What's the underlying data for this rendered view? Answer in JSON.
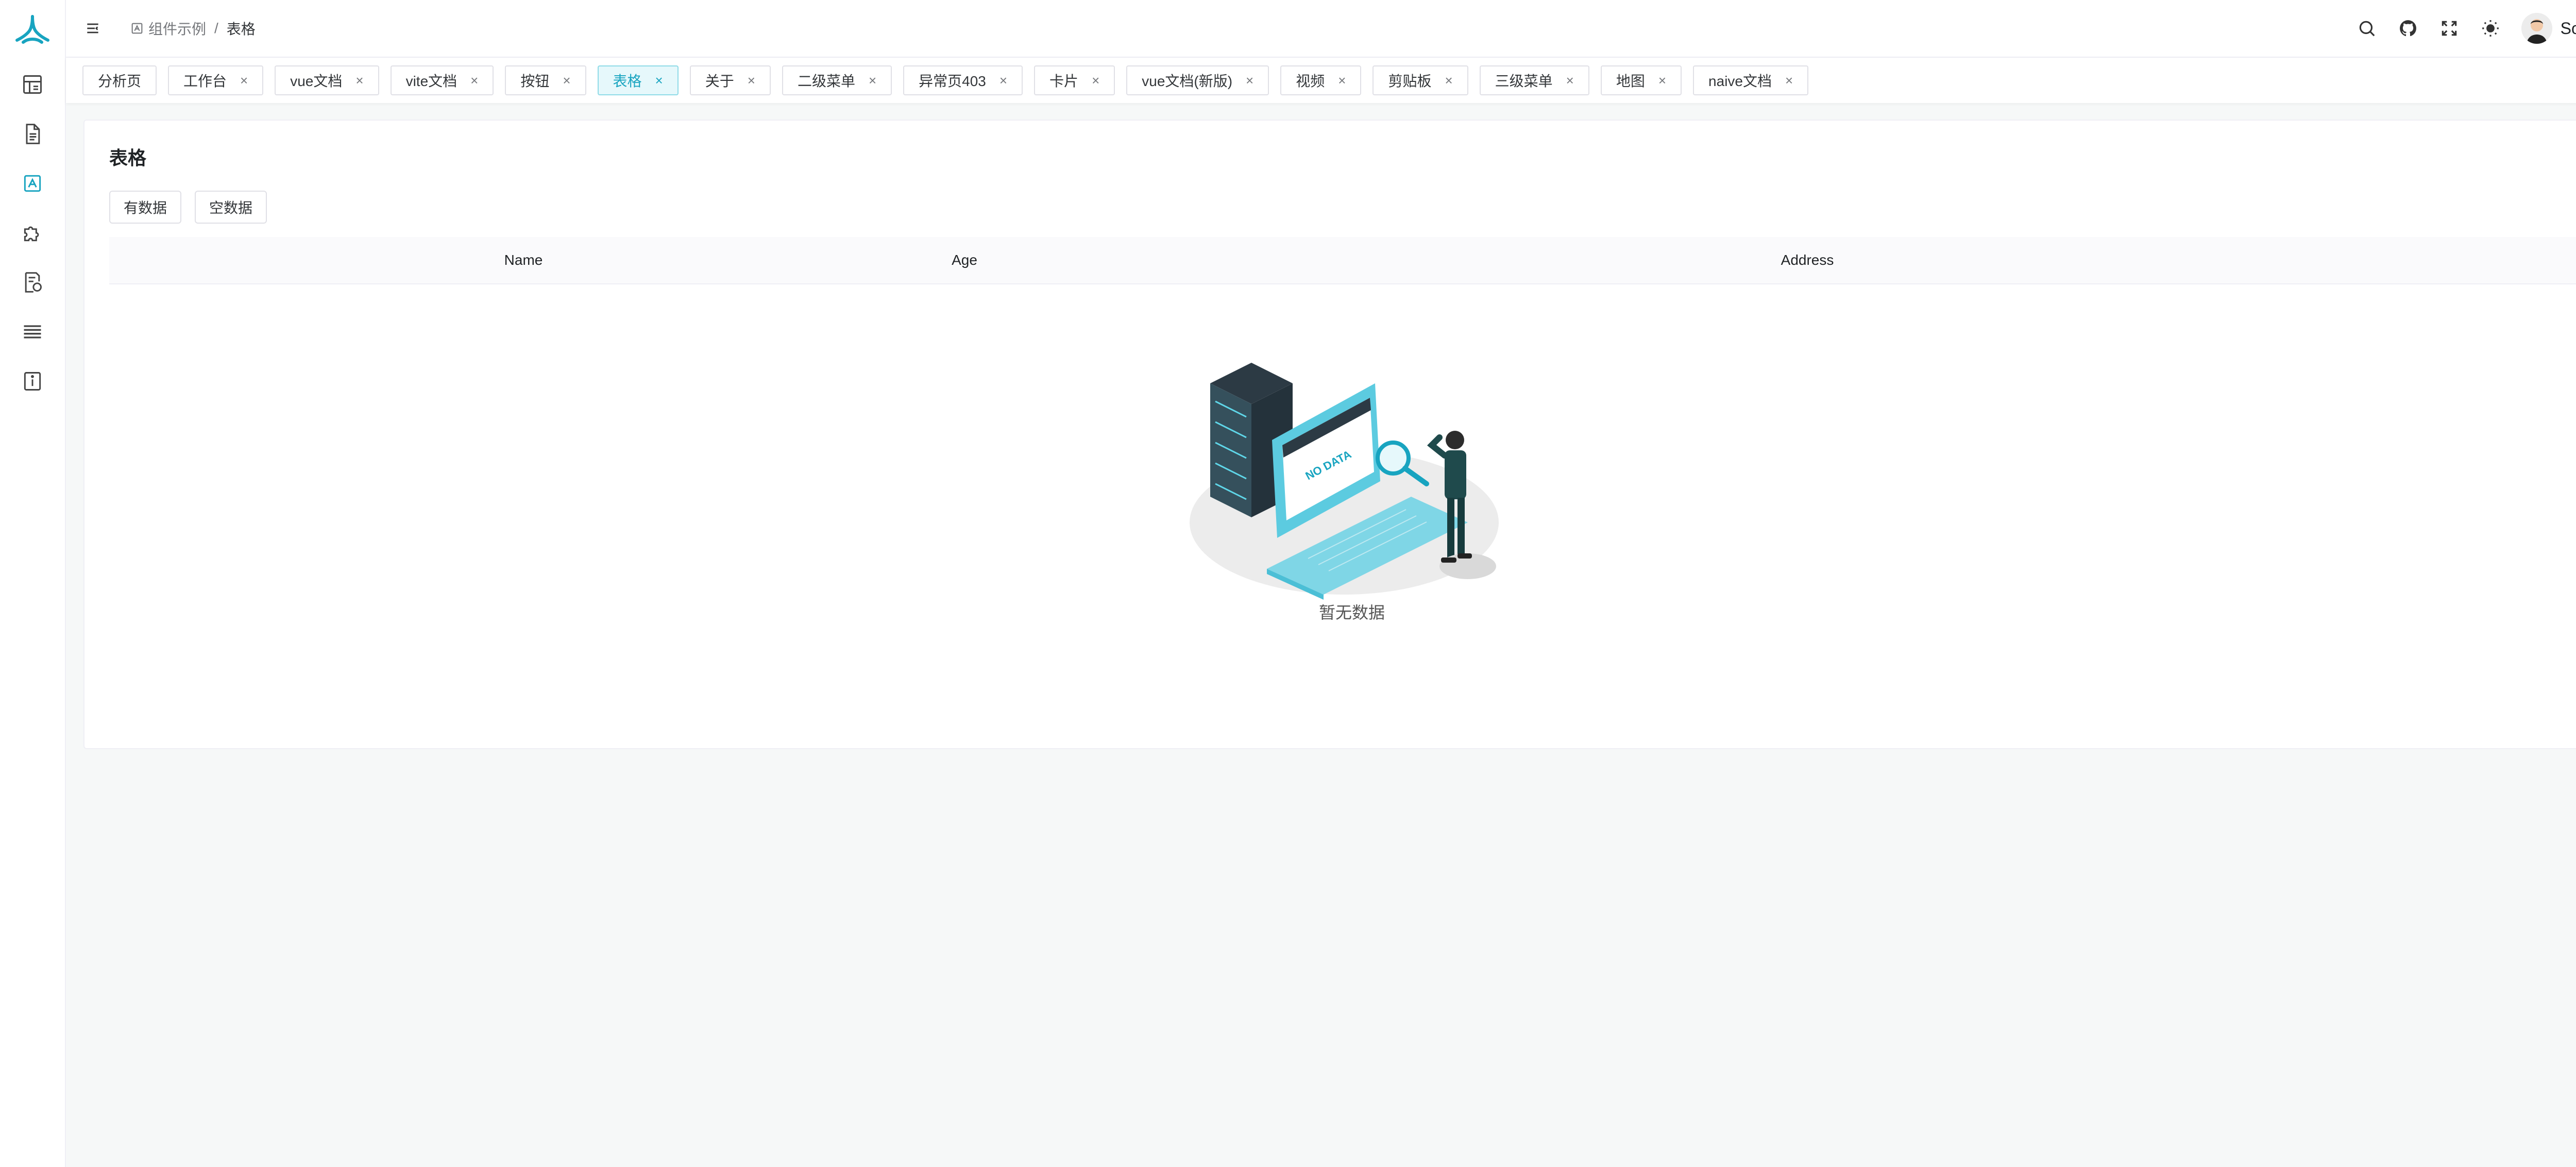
{
  "header": {
    "breadcrumb": [
      {
        "label": "组件示例",
        "icon": "component-icon"
      },
      {
        "label": "表格"
      }
    ],
    "separator": "/",
    "username": "Soybean",
    "icons": [
      "search-icon",
      "github-icon",
      "fullscreen-icon",
      "theme-sun-icon"
    ]
  },
  "sidebar": {
    "items": [
      {
        "icon": "dashboard-icon"
      },
      {
        "icon": "document-icon"
      },
      {
        "icon": "component-icon",
        "active": true
      },
      {
        "icon": "plugin-icon"
      },
      {
        "icon": "exception-icon"
      },
      {
        "icon": "menu-list-icon"
      },
      {
        "icon": "about-icon"
      }
    ]
  },
  "tabs": [
    {
      "label": "分析页",
      "closable": false
    },
    {
      "label": "工作台",
      "closable": true
    },
    {
      "label": "vue文档",
      "closable": true
    },
    {
      "label": "vite文档",
      "closable": true
    },
    {
      "label": "按钮",
      "closable": true
    },
    {
      "label": "表格",
      "closable": true,
      "active": true
    },
    {
      "label": "关于",
      "closable": true
    },
    {
      "label": "二级菜单",
      "closable": true
    },
    {
      "label": "异常页403",
      "closable": true
    },
    {
      "label": "卡片",
      "closable": true
    },
    {
      "label": "vue文档(新版)",
      "closable": true
    },
    {
      "label": "视频",
      "closable": true
    },
    {
      "label": "剪贴板",
      "closable": true
    },
    {
      "label": "三级菜单",
      "closable": true
    },
    {
      "label": "地图",
      "closable": true
    },
    {
      "label": "naive文档",
      "closable": true
    }
  ],
  "close_glyph": "×",
  "card": {
    "title": "表格",
    "buttons": [
      "有数据",
      "空数据"
    ],
    "columns": [
      "Name",
      "Age",
      "Address"
    ],
    "empty_text": "暂无数据",
    "illustration_text": "NO DATA"
  },
  "colors": {
    "primary": "#18a4c0",
    "active_tab_bg": "#e6f8fb"
  }
}
